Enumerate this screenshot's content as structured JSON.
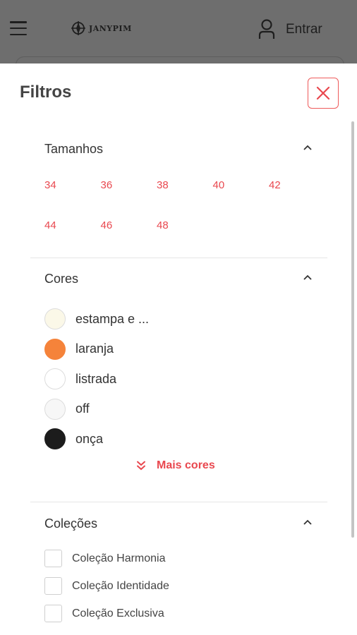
{
  "header": {
    "logo_text": "JANYPIM",
    "login_label": "Entrar"
  },
  "drawer": {
    "title": "Filtros",
    "close_icon": "close-icon"
  },
  "sizes": {
    "title": "Tamanhos",
    "items": [
      "34",
      "36",
      "38",
      "40",
      "42",
      "44",
      "46",
      "48"
    ]
  },
  "colors": {
    "title": "Cores",
    "items": [
      {
        "label": "estampa e ...",
        "swatch": "#fbf8e8"
      },
      {
        "label": "laranja",
        "swatch": "#f5833a"
      },
      {
        "label": "listrada",
        "swatch": "#ffffff"
      },
      {
        "label": "off",
        "swatch": "#f7f7f7"
      },
      {
        "label": "onça",
        "swatch": "#1c1c1c"
      }
    ],
    "more_label": "Mais cores"
  },
  "collections": {
    "title": "Coleções",
    "items": [
      {
        "label": "Coleção Harmonia"
      },
      {
        "label": "Coleção Identidade"
      },
      {
        "label": "Coleção Exclusiva"
      }
    ]
  },
  "theme": {
    "accent": "#e9484f",
    "overlay": "#6e6e6e"
  }
}
